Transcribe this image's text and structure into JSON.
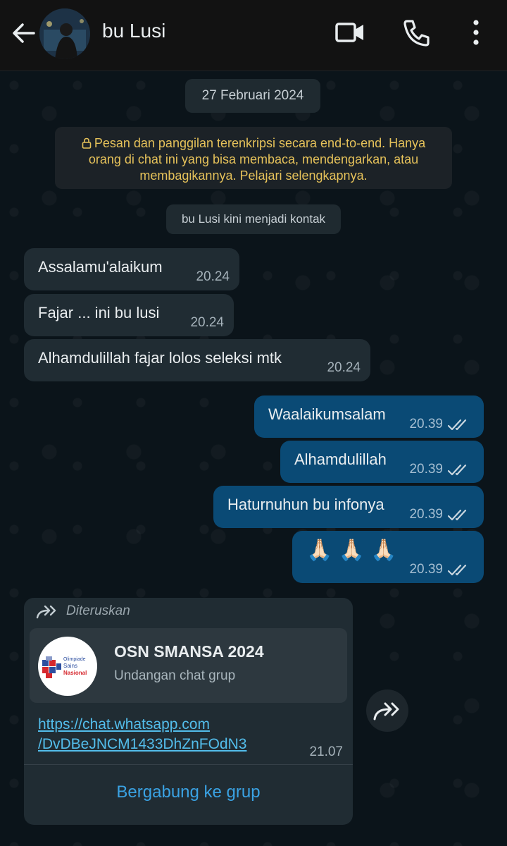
{
  "header": {
    "contact_name": "bu Lusi"
  },
  "chat": {
    "date": "27 Februari 2024",
    "encryption_notice": "Pesan dan panggilan terenkripsi secara end-to-end. Hanya orang di chat ini yang bisa membaca, mendengarkan, atau membagikannya. Pelajari selengkapnya.",
    "contact_notice": "bu Lusi kini menjadi kontak",
    "incoming": [
      {
        "text": "Assalamu'alaikum",
        "time": "20.24"
      },
      {
        "text": "Fajar ... ini bu lusi",
        "time": "20.24"
      },
      {
        "text": "Alhamdulillah fajar lolos seleksi mtk",
        "time": "20.24"
      }
    ],
    "outgoing": [
      {
        "text": "Waalaikumsalam",
        "time": "20.39"
      },
      {
        "text": "Alhamdulillah",
        "time": "20.39"
      },
      {
        "text": "Haturnuhun bu infonya",
        "time": "20.39"
      },
      {
        "text": "🙏🏻 🙏🏻 🙏🏻",
        "time": "20.39"
      }
    ],
    "forwarded": {
      "label": "Diteruskan",
      "group_name": "OSN SMANSA 2024",
      "group_subtitle": "Undangan chat grup",
      "link_line1": "https://chat.whatsapp.com",
      "link_line2": "/DvDBeJNCM1433DhZnFOdN3",
      "time": "21.07",
      "join_label": "Bergabung ke grup"
    }
  },
  "colors": {
    "incoming_bubble": "#202c33",
    "outgoing_bubble": "#0a4a75",
    "link": "#53bdeb",
    "encryption_text": "#e6c25a"
  },
  "logo_text": {
    "line1": "Olimpiade",
    "line2": "Sains",
    "line3": "Nasional"
  }
}
